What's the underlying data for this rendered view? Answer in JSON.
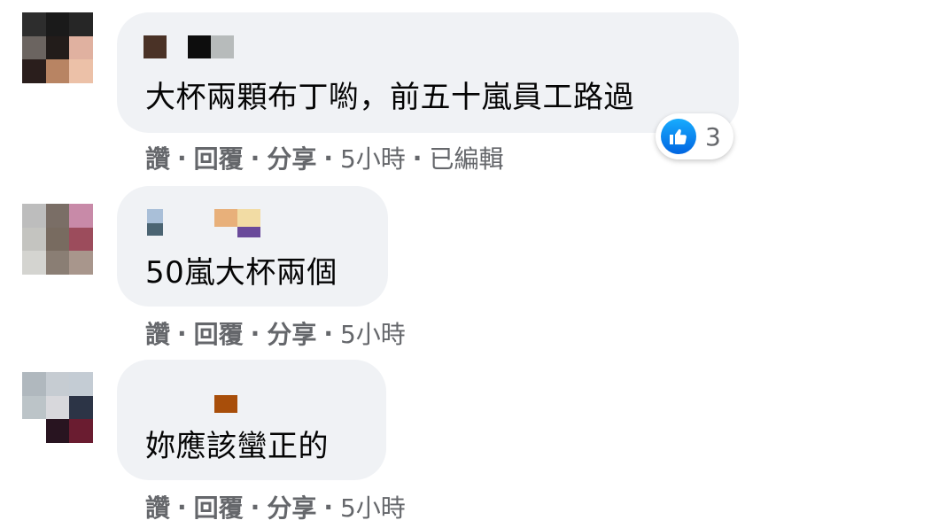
{
  "colors": {
    "bubble": "#f0f2f5",
    "meta_text": "#65676b",
    "comment_text": "#050505",
    "like_blue": "#1877f2"
  },
  "comments": [
    {
      "text": "大杯兩顆布丁喲，前五十嵐員工路過",
      "actions": {
        "like": "讚",
        "reply": "回覆",
        "share": "分享"
      },
      "time": "5小時",
      "edited": "已編輯",
      "reaction": {
        "icon": "like-icon",
        "count": "3"
      }
    },
    {
      "text": "50嵐大杯兩個",
      "actions": {
        "like": "讚",
        "reply": "回覆",
        "share": "分享"
      },
      "time": "5小時"
    },
    {
      "text": "妳應該蠻正的",
      "actions": {
        "like": "讚",
        "reply": "回覆",
        "share": "分享"
      },
      "time": "5小時"
    }
  ],
  "separator": "·"
}
